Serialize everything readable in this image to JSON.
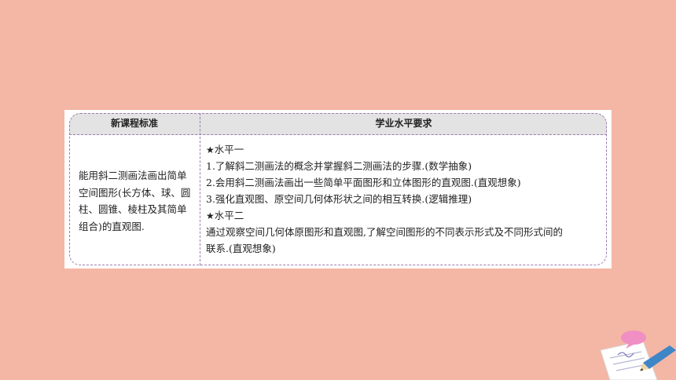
{
  "table": {
    "header_left": "新课程标准",
    "header_right": "学业水平要求",
    "left_text": "能用斜二测画法画出简单空间图形(长方体、球、圆柱、圆锥、棱柱及其简单组合)的直观图.",
    "level1_title": "水平一",
    "level1_items": [
      "1.了解斜二测画法的概念并掌握斜二测画法的步骤.(数学抽象)",
      "2.会用斜二测画法画出一些简单平面图形和立体图形的直观图.(直观想象)",
      "3.强化直观图、原空间几何体形状之间的相互转换.(逻辑推理)"
    ],
    "level2_title": "水平二",
    "level2_text_line1": "通过观察空间几何体原图形和直观图,了解空间图形的不同表示形式及不同形式间的",
    "level2_text_line2": "联系.(直观想象)"
  },
  "colors": {
    "background": "#f4b6a5",
    "header_bg": "#e3e3e3",
    "dashed_border": "#9b7bb0"
  },
  "icons": {
    "star": "star-icon",
    "decoration": "paper-pencil-decoration"
  }
}
